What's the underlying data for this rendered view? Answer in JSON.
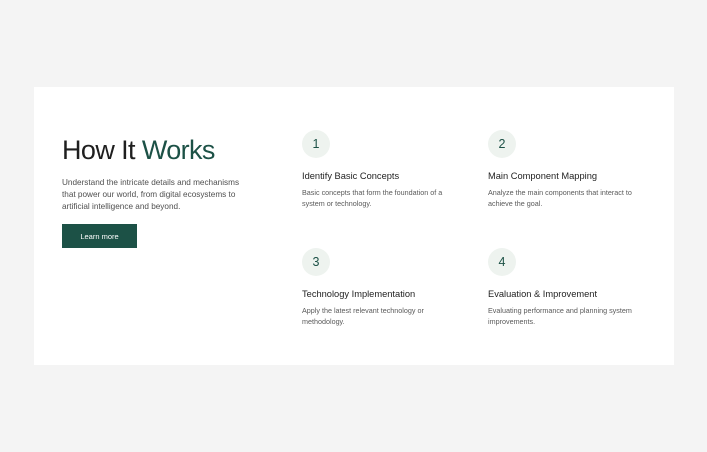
{
  "intro": {
    "title_prefix": "How It",
    "title_accent": "Works",
    "description": "Understand the intricate details and mechanisms that power our world, from digital ecosystems to artificial intelligence and beyond.",
    "button_label": "Learn more"
  },
  "steps": [
    {
      "number": "1",
      "title": "Identify Basic Concepts",
      "description": "Basic concepts that form the foundation of a system or technology."
    },
    {
      "number": "2",
      "title": "Main Component Mapping",
      "description": "Analyze the main components that interact to achieve the goal."
    },
    {
      "number": "3",
      "title": "Technology Implementation",
      "description": "Apply the latest relevant technology or methodology."
    },
    {
      "number": "4",
      "title": "Evaluation & Improvement",
      "description": "Evaluating performance and planning system improvements."
    }
  ],
  "colors": {
    "accent": "#1c5146",
    "page_background": "#f4f4f4",
    "card_background": "#ffffff",
    "number_badge": "#eef3ef"
  }
}
